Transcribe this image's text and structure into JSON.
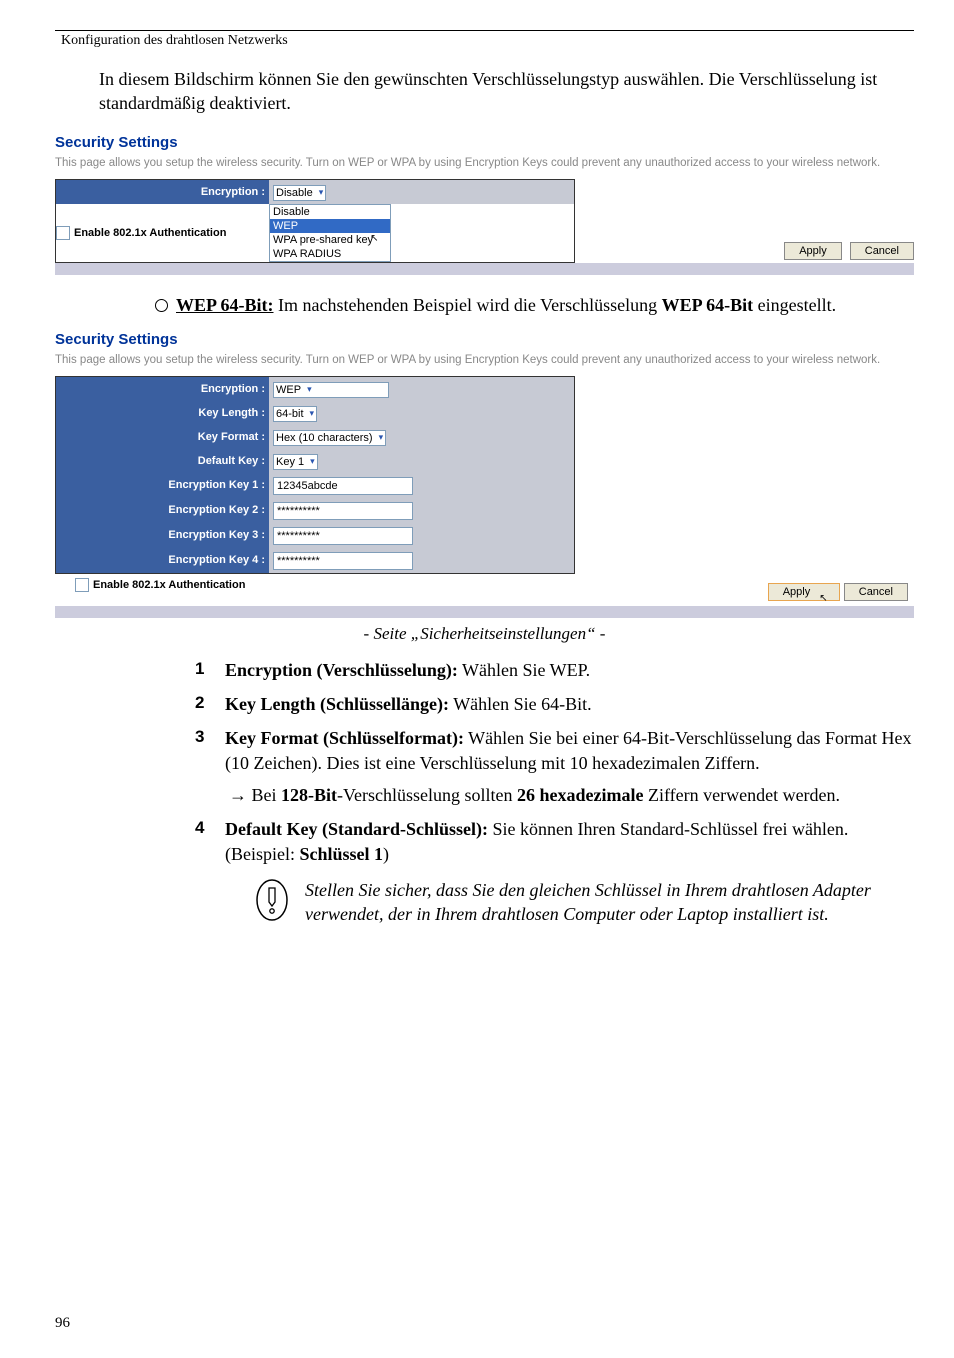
{
  "header": "Konfiguration des drahtlosen Netzwerks",
  "intro": "In diesem Bildschirm können Sie den gewünschten Verschlüsselungstyp auswählen. Die Verschlüsselung ist standardmäßig deaktiviert.",
  "panel1": {
    "title": "Security Settings",
    "desc": "This page allows you setup the wireless security. Turn on WEP or WPA by using Encryption Keys could prevent any unauthorized access to your wireless network.",
    "encryption_label": "Encryption :",
    "encryption_value": "Disable",
    "options": {
      "o1": "Disable",
      "o2": "WEP",
      "o3": "WPA pre-shared key",
      "o4": "WPA RADIUS"
    },
    "enable8021x": "Enable 802.1x Authentication",
    "apply": "Apply",
    "cancel": "Cancel"
  },
  "wep": {
    "heading_strong": "WEP 64-Bit:",
    "heading_rest": " Im nachstehenden Beispiel wird die Verschlüsselung ",
    "heading_strong2": "WEP 64-Bit",
    "heading_end": " eingestellt."
  },
  "panel2": {
    "title": "Security Settings",
    "desc": "This page allows you setup the wireless security. Turn on WEP or WPA by using Encryption Keys could prevent any unauthorized access to your wireless network.",
    "labels": {
      "encryption": "Encryption :",
      "keylength": "Key Length :",
      "keyformat": "Key Format :",
      "defaultkey": "Default Key :",
      "k1": "Encryption Key 1 :",
      "k2": "Encryption Key 2 :",
      "k3": "Encryption Key 3 :",
      "k4": "Encryption Key 4 :"
    },
    "values": {
      "encryption": "WEP",
      "keylength": "64-bit",
      "keyformat": "Hex (10 characters)",
      "defaultkey": "Key 1",
      "k1": "12345abcde",
      "masked": "**********"
    },
    "enable8021x": "Enable 802.1x Authentication",
    "apply": "Apply",
    "cancel": "Cancel"
  },
  "caption": "- Seite „Sicherheitseinstellungen“ -",
  "steps": {
    "s1": {
      "n": "1",
      "b": "Encryption (Verschlüsselung):",
      "t": " Wählen Sie WEP."
    },
    "s2": {
      "n": "2",
      "b": "Key Length (Schlüssellänge):",
      "t": " Wählen Sie 64-Bit."
    },
    "s3": {
      "n": "3",
      "b": "Key Format (Schlüsselformat):",
      "t": " Wählen Sie bei einer 64-Bit-Verschlüsselung das Format Hex (10 Zeichen). Dies ist eine Verschlüsselung mit 10 hexadezimalen Ziffern.",
      "sub_pre": " Bei ",
      "sub_b1": "128-Bit",
      "sub_mid": "-Verschlüsselung sollten ",
      "sub_b2": "26 hexadezimale",
      "sub_end": " Ziffern verwendet werden."
    },
    "s4": {
      "n": "4",
      "b": "Default Key (Standard-Schlüssel):",
      "t": " Sie können Ihren Standard-Schlüssel frei wählen. (Beispiel: ",
      "b2": "Schlüssel 1",
      "t2": ")"
    }
  },
  "note": "Stellen Sie sicher, dass Sie den gleichen Schlüssel in Ihrem drahtlosen Adapter verwendet, der in Ihrem drahtlosen Computer oder Laptop installiert ist.",
  "pagenum": "96"
}
